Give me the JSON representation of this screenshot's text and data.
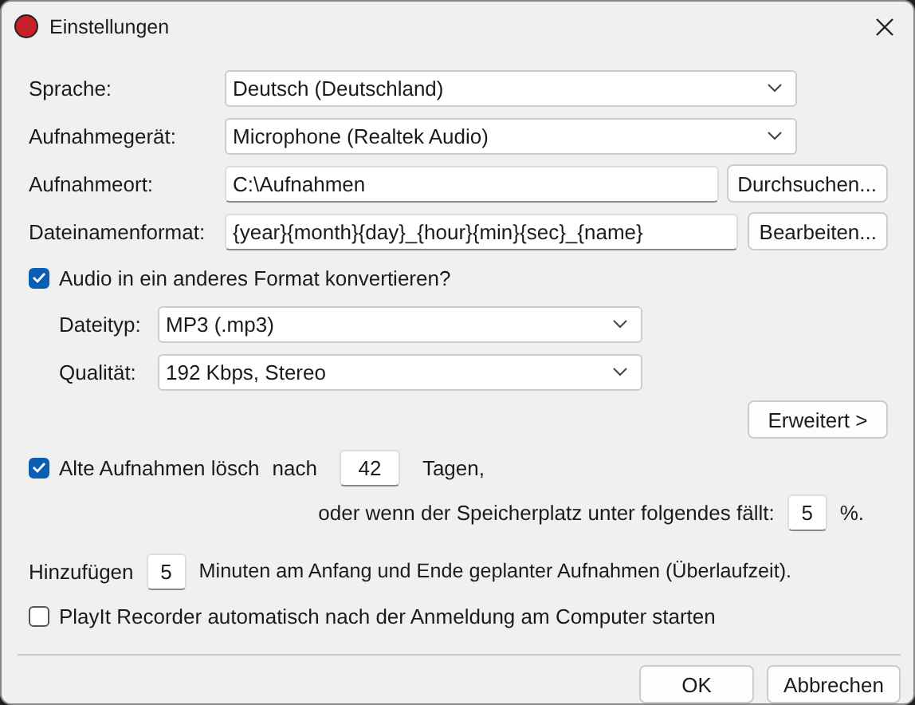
{
  "window": {
    "title": "Einstellungen"
  },
  "fields": [
    {
      "kind": "dropdown",
      "label": "Sprache:",
      "value": "Deutsch (Deutschland)"
    },
    {
      "kind": "dropdown",
      "label": "Aufnahmegerät:",
      "value": "Microphone (Realtek Audio)"
    },
    {
      "kind": "text",
      "label": "Aufnahmeort:",
      "value": "C:\\Aufnahmen",
      "button": "Durchsuchen..."
    },
    {
      "kind": "text",
      "label": "Dateinamenformat:",
      "value": "{year}{month}{day}_{hour}{min}{sec}_{name}",
      "button": "Bearbeiten..."
    }
  ],
  "convert": {
    "label": "Audio in ein anderes Format konvertieren?",
    "checked": true,
    "fields": [
      {
        "label": "Dateityp:",
        "value": "MP3 (.mp3)"
      },
      {
        "label": "Qualität:",
        "value": "192 Kbps, Stereo"
      }
    ],
    "advanced_button": "Erweitert >"
  },
  "cleanup": {
    "label": "Alte Aufnahmen lösch",
    "checked": true,
    "after": "nach",
    "days": "42",
    "days_unit": "Tagen,",
    "space_text": "oder wenn der Speicherplatz unter folgendes fällt:",
    "percent": "5",
    "percent_unit": "%."
  },
  "overrun": {
    "prefix": "Hinzufügen",
    "minutes": "5",
    "suffix": "Minuten am Anfang und Ende geplanter Aufnahmen (Überlaufzeit)."
  },
  "autostart": {
    "label": "PlayIt Recorder automatisch nach der Anmeldung am Computer starten",
    "checked": false
  },
  "buttons": [
    {
      "label": "OK",
      "kind": "default"
    },
    {
      "label": "Abbrechen",
      "kind": "normal"
    }
  ]
}
